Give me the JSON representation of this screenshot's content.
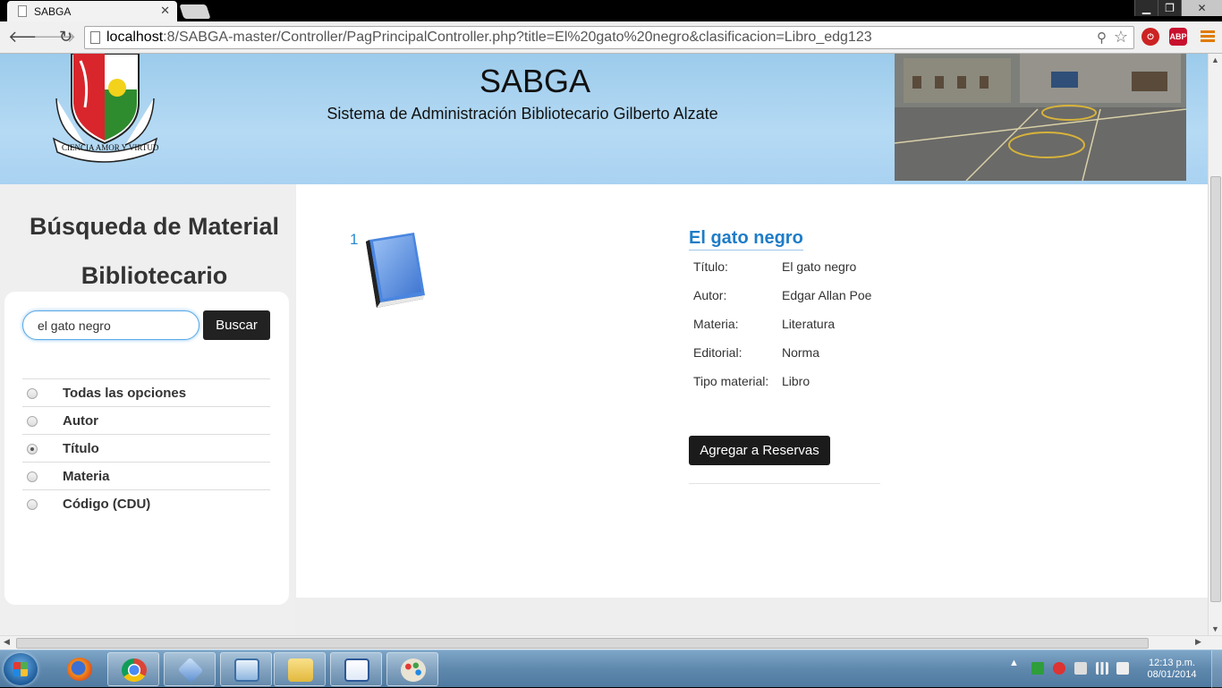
{
  "browser": {
    "tab_title": "SABGA",
    "tab_close": "✕",
    "url_host": "localhost",
    "url_rest": ":8/SABGA-master/Controller/PagPrincipalController.php?title=El%20gato%20negro&clasificacion=Libro_edg123",
    "back_icon": "arrow-left-icon",
    "forward_icon": "arrow-right-icon",
    "reload_icon": "reload-icon",
    "ext_abp": "ABP"
  },
  "header": {
    "title": "SABGA",
    "subtitle": "Sistema de Administración Bibliotecario Gilberto Alzate",
    "crest_text": "GILBERTO ALZATE AVENDAÑO — CIENCIA AMOR Y VIRTUD"
  },
  "sidebar": {
    "title": "Búsqueda de Material Bibliotecario",
    "search_value": "el gato negro",
    "search_button": "Buscar",
    "options": [
      {
        "label": "Todas las opciones",
        "selected": false
      },
      {
        "label": "Autor",
        "selected": false
      },
      {
        "label": "Título",
        "selected": true
      },
      {
        "label": "Materia",
        "selected": false
      },
      {
        "label": "Código (CDU)",
        "selected": false
      }
    ]
  },
  "result": {
    "number": "1",
    "title": "El gato negro",
    "fields": [
      {
        "key": "Título:",
        "value": "El gato negro"
      },
      {
        "key": "Autor:",
        "value": "Edgar Allan Poe"
      },
      {
        "key": "Materia:",
        "value": "Literatura"
      },
      {
        "key": "Editorial:",
        "value": "Norma"
      },
      {
        "key": "Tipo material:",
        "value": "Libro"
      }
    ],
    "reserve_button": "Agregar a Reservas"
  },
  "taskbar": {
    "time": "12:13 p.m.",
    "date": "08/01/2014"
  },
  "colors": {
    "link_blue": "#1e7cc7",
    "banner_blue": "#aad3f2",
    "button_dark": "#1b1b1b"
  }
}
